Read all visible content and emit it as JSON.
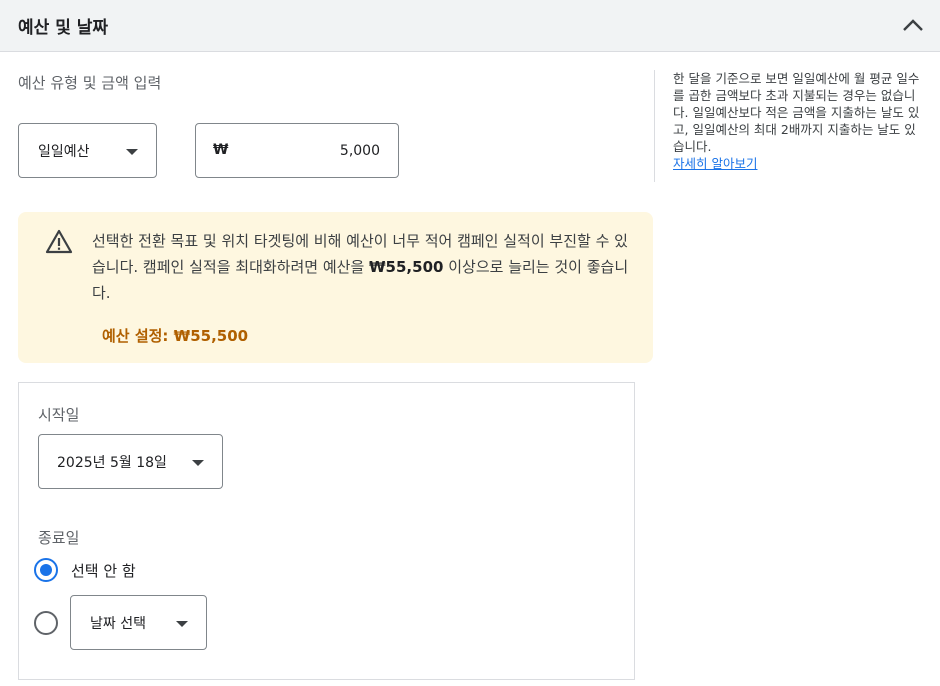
{
  "header": {
    "title": "예산 및 날짜"
  },
  "budget": {
    "section_label": "예산 유형 및 금액 입력",
    "type_value": "일일예산",
    "currency_symbol": "₩",
    "amount_value": "5,000"
  },
  "side_note": {
    "text": "한 달을 기준으로 보면 일일예산에 월 평균 일수를 곱한 금액보다 초과 지불되는 경우는 없습니다. 일일예산보다 적은 금액을 지출하는 날도 있고, 일일예산의 최대 2배까지 지출하는 날도 있습니다.",
    "link": "자세히 알아보기"
  },
  "warning": {
    "text_before": "선택한 전환 목표 및 위치 타겟팅에 비해 예산이 너무 적어 캠페인 실적이 부진할 수 있습니다. 캠페인 실적을 최대화하려면 예산을 ",
    "recommended_amount": "₩55,500",
    "text_after": " 이상으로 늘리는 것이 좋습니다.",
    "action_label": "예산 설정: ₩55,500",
    "color": "#fef7e0"
  },
  "dates": {
    "start_label": "시작일",
    "start_value": "2025년 5월 18일",
    "end_label": "종료일",
    "none_option": "선택 안 함",
    "choose_date": "날짜 선택"
  },
  "colors": {
    "accent": "#1a73e8",
    "warning_text": "#b06000",
    "header_bg": "#f1f3f4"
  },
  "icons": {
    "collapse": "chevron-up-icon",
    "warning": "warning-triangle-icon",
    "dropdown": "caret-down-icon"
  }
}
